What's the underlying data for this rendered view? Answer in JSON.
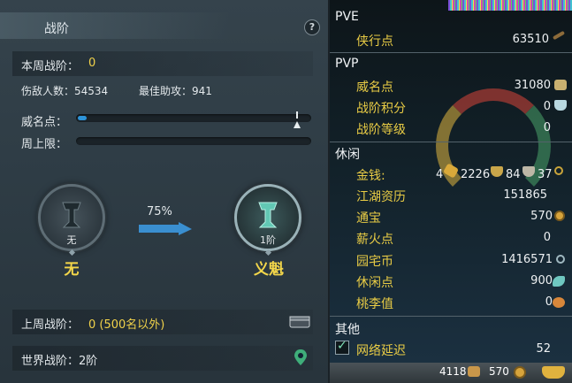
{
  "left": {
    "title": "战阶",
    "help": "?",
    "week_rank_label": "本周战阶：",
    "week_rank_value": "0",
    "kills_label": "伤敌人数：54534",
    "assists_label": "最佳助攻：941",
    "fame_label": "威名点：",
    "fame_progress": 0.04,
    "weekly_cap_label": "周上限：",
    "weekly_cap_progress": 0,
    "current_rank_caption": "无",
    "current_rank_name": "无",
    "next_rank_caption": "1阶",
    "next_rank_name": "义魁",
    "progress_percent": "75%",
    "last_week_label": "上周战阶：",
    "last_week_value": "0 (500名以外)",
    "world_rank_label": "世界战阶：2阶"
  },
  "right": {
    "pve_header": "PVE",
    "pvp_header": "PVP",
    "leisure_header": "休闲",
    "other_header": "其他",
    "pve": [
      {
        "label": "侠行点",
        "value": "63510"
      }
    ],
    "pvp": [
      {
        "label": "威名点",
        "value": "31080"
      },
      {
        "label": "战阶积分",
        "value": "0"
      },
      {
        "label": "战阶等级",
        "value": "0"
      }
    ],
    "money": {
      "label": "金钱:",
      "gold_prefix": "4",
      "silver": "2226",
      "copper_a": "84",
      "copper_b": "37"
    },
    "leisure": [
      {
        "label": "江湖资历",
        "value": "151865"
      },
      {
        "label": "通宝",
        "value": "570"
      },
      {
        "label": "薪火点",
        "value": "0"
      },
      {
        "label": "园宅币",
        "value": "1416571"
      },
      {
        "label": "休闲点",
        "value": "900"
      },
      {
        "label": "桃李值",
        "value": "0"
      }
    ],
    "latency": {
      "label": "网络延迟",
      "value": "52",
      "checked": true
    }
  },
  "bottom_bar": {
    "value_a": "4118",
    "value_b": "570"
  },
  "colors": {
    "accent_yellow": "#f1d24a",
    "progress_blue": "#2d93d8",
    "check_green": "#7fe0b6"
  }
}
